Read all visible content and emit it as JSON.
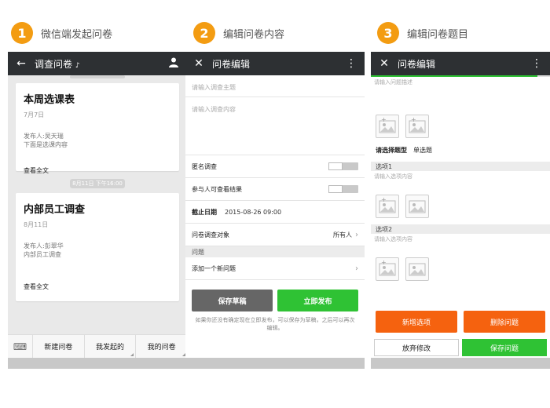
{
  "steps": [
    {
      "num": "1",
      "label": "微信端发起问卷"
    },
    {
      "num": "2",
      "label": "编辑问卷内容"
    },
    {
      "num": "3",
      "label": "编辑问卷题目"
    }
  ],
  "phone1": {
    "title": "调查问卷",
    "cards": [
      {
        "title": "本周选课表",
        "date": "7月7日",
        "publisher": "发布人:吴天瑞",
        "desc": "下面是选课内容",
        "more": "查看全文"
      },
      {
        "title": "内部员工调查",
        "date": "8月11日",
        "publisher": "发布人:彭翠华",
        "desc": "内部员工调查",
        "more": "查看全文"
      }
    ],
    "time_badge": "8月11日 下午16:00",
    "tabs": [
      "新建问卷",
      "我发起的",
      "我的问卷"
    ]
  },
  "phone2": {
    "title": "问卷编辑",
    "subject_placeholder": "请输入调查主题",
    "content_placeholder": "请输入调查内容",
    "anonymous_label": "匿名调查",
    "participants_label": "参与人可查看结果",
    "deadline_label": "截止日期",
    "deadline_value": "2015-08-26 09:00",
    "target_label": "问卷调查对象",
    "target_value": "所有人",
    "section_label": "问题",
    "add_question_label": "添加一个新问题",
    "save_draft": "保存草稿",
    "publish": "立即发布",
    "hint": "如果你还没有确定现在立即发布，可以保存为草稿，之后可以再次编辑。"
  },
  "phone3": {
    "title": "问卷编辑",
    "progress": 0.93,
    "desc_placeholder": "请输入问题描述",
    "type_label": "请选择题型",
    "type_value": "单选题",
    "options": [
      {
        "label": "选项1",
        "placeholder": "请输入选项内容"
      },
      {
        "label": "选项2",
        "placeholder": "请输入选项内容"
      }
    ],
    "add_option": "新增选项",
    "delete_question": "删除问题",
    "discard": "放弃修改",
    "save_question": "保存问题"
  },
  "colors": {
    "accent_orange": "#f39c12",
    "button_orange": "#f5620f",
    "green": "#2fc234",
    "topbar": "#2d3033"
  }
}
